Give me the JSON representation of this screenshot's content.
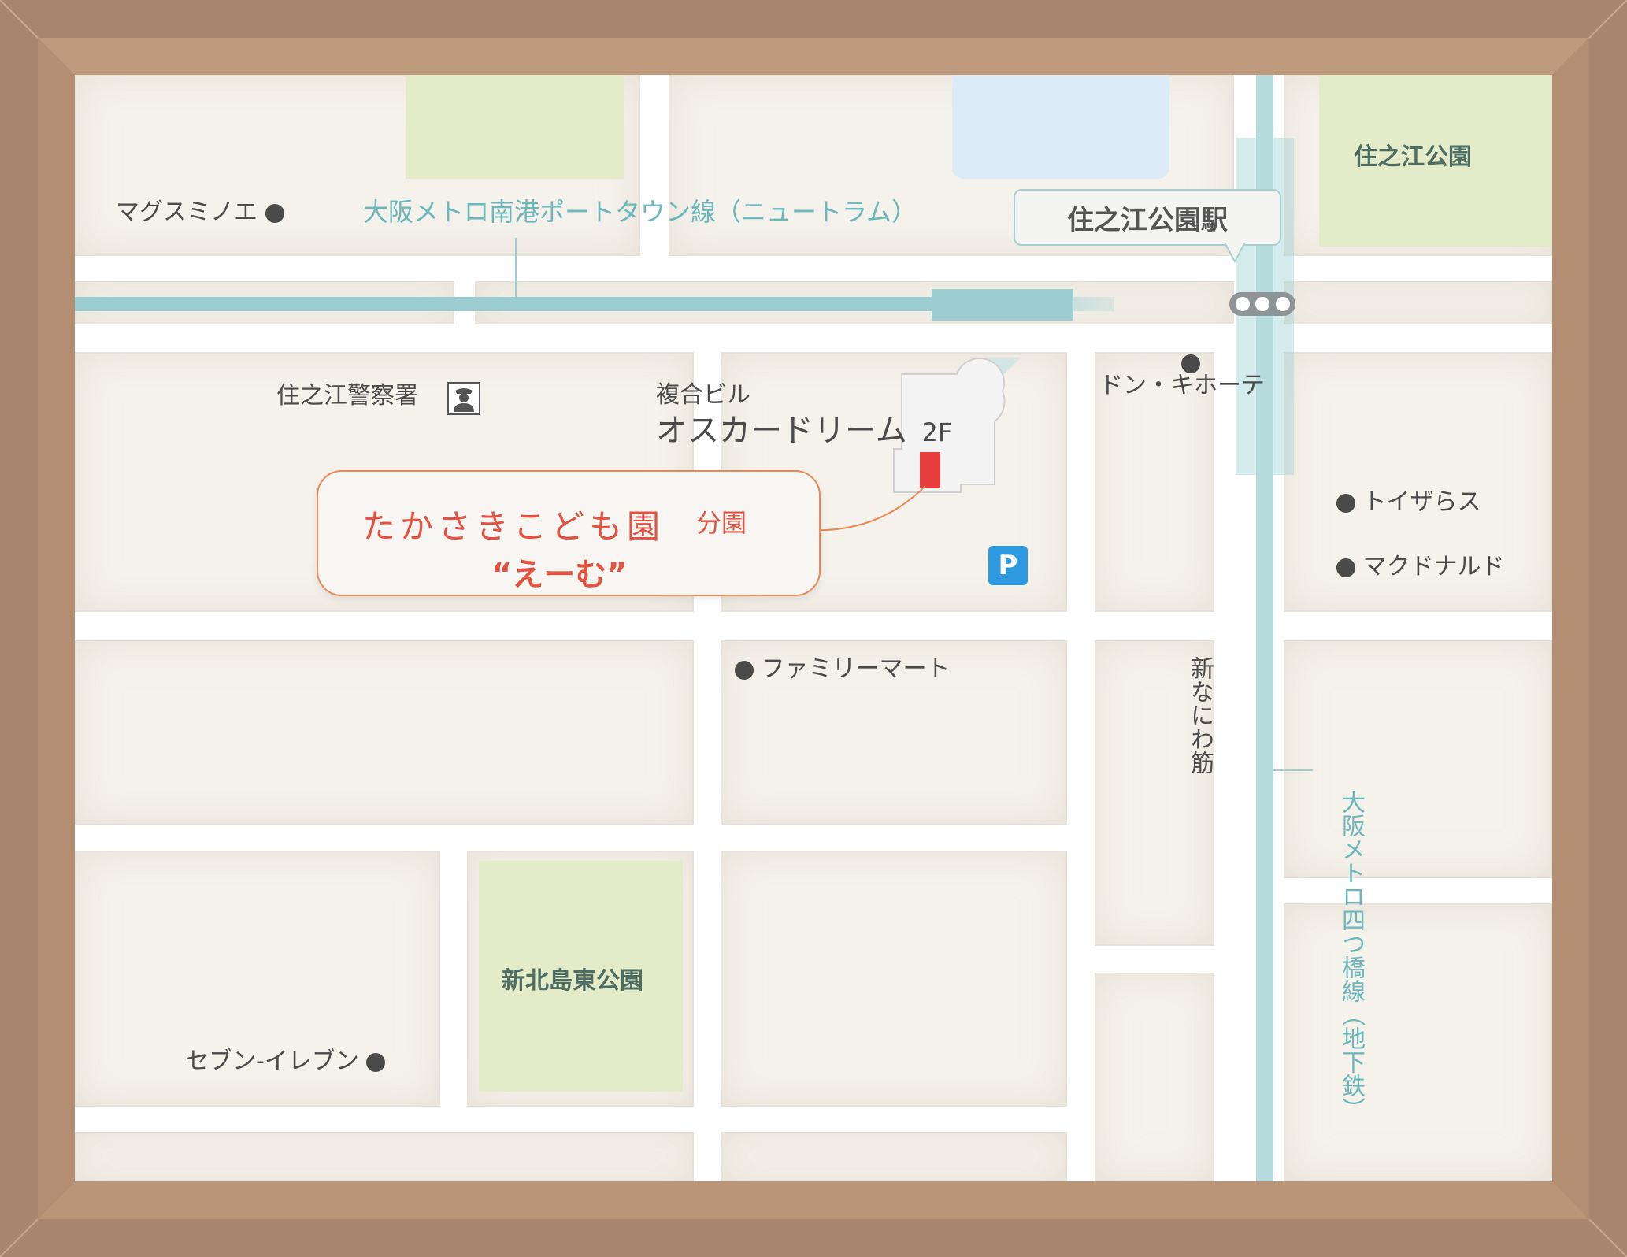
{
  "colors": {
    "frame_outer": "#a9856d",
    "frame_inner": "#bc9679",
    "block_fill": "#f5f2ec",
    "park_fill": "#e3ebc8",
    "water_fill": "#dcebf5",
    "rail_color": "#9bcdd1",
    "callout_text": "#e35240",
    "callout_border": "#e78a55",
    "target_marker": "#e83d3d",
    "parking_blue": "#2f9ae0"
  },
  "rail_lines": {
    "newtram_label": "大阪メトロ南港ポートタウン線（ニュートラム）",
    "yotsubashi_label": "大阪メトロ四つ橋線（地下鉄）"
  },
  "station": {
    "name": "住之江公園駅",
    "icon": "station-dots-icon"
  },
  "street": {
    "name": "新なにわ筋"
  },
  "parks": {
    "suminoe_park": "住之江公園",
    "shinkitajima_park": "新北島東公園"
  },
  "landmarks": {
    "magusuminoe": "マグスミノエ",
    "police": "住之江警察署",
    "police_icon": "police-officer-icon",
    "donki": "ドン・キホーテ",
    "toysrus": "トイザらス",
    "mcdonalds": "マクドナルド",
    "familymart": "ファミリーマート",
    "seven_eleven": "セブン-イレブン"
  },
  "building": {
    "type_label": "複合ビル",
    "name": "オスカードリーム",
    "floor": "2F"
  },
  "parking": {
    "label": "P",
    "icon": "parking-icon"
  },
  "callout": {
    "main": "たかさきこども園",
    "sub": "分園",
    "nickname": "“えーむ”"
  }
}
